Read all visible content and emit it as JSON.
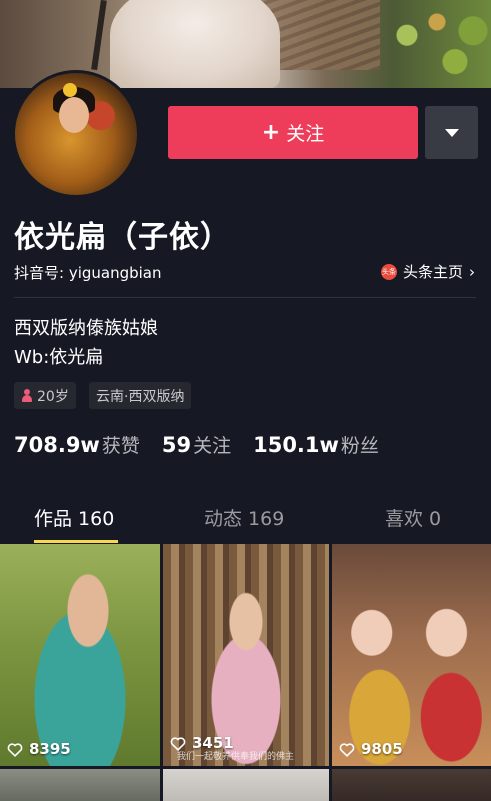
{
  "profile": {
    "name": "依光扁（子依）",
    "douyin_id": "抖音号: yiguangbian",
    "toutiao_icon": "头条",
    "toutiao_link": "头条主页",
    "bio_line1": "西双版纳傣族姑娘",
    "bio_line2": "Wb:依光扁"
  },
  "actions": {
    "follow_plus": "+",
    "follow_label": "关注"
  },
  "tags": {
    "age": "20岁",
    "location": "云南·西双版纳"
  },
  "stats": [
    {
      "num": "708.9w",
      "label": "获赞"
    },
    {
      "num": "59",
      "label": "关注"
    },
    {
      "num": "150.1w",
      "label": "粉丝"
    }
  ],
  "tabs": [
    {
      "label": "作品 160"
    },
    {
      "label": "动态 169"
    },
    {
      "label": "喜欢 0"
    }
  ],
  "videos": [
    {
      "likes": "8395"
    },
    {
      "likes": "3451",
      "caption": "我们一起敬养供奉我们的佛主"
    },
    {
      "likes": "9805"
    }
  ],
  "colors": {
    "background": "#161823",
    "follow_button": "#ee3d5a",
    "tab_indicator": "#f8d64e"
  },
  "icons": [
    "chevron-down-icon",
    "toutiao-icon",
    "chevron-right-icon",
    "female-icon",
    "heart-icon"
  ]
}
